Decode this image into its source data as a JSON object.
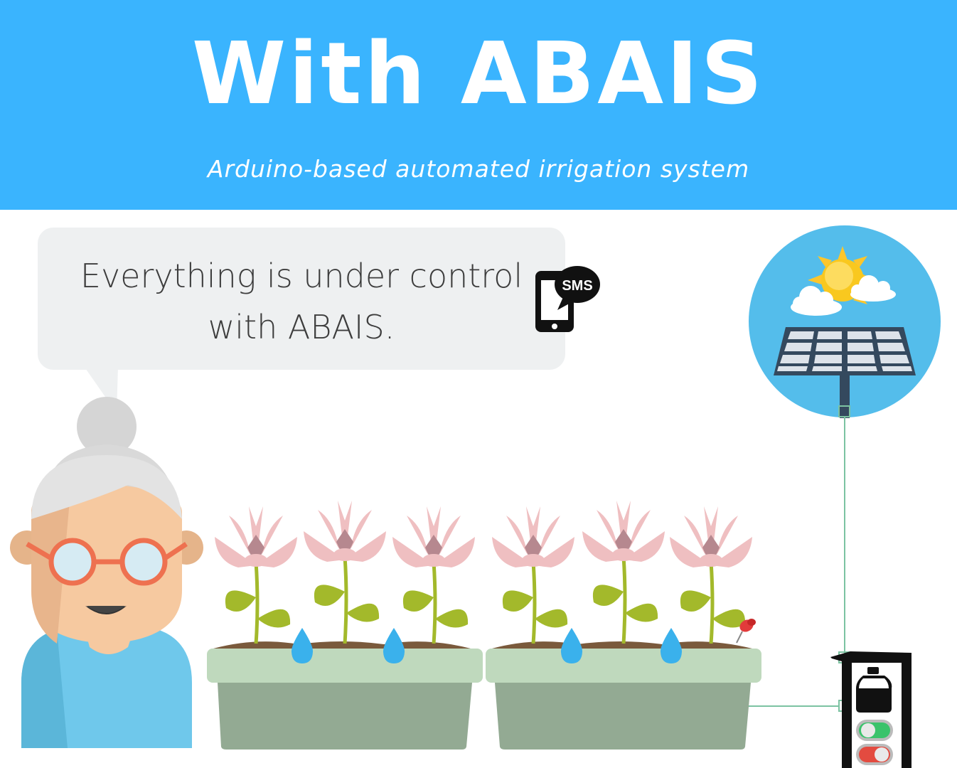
{
  "header": {
    "title": "With ABAIS",
    "subtitle": "Arduino-based automated irrigation system"
  },
  "speech_bubble": {
    "line1": "Everything is under control",
    "line2": "with ABAIS."
  },
  "phone": {
    "badge": "SMS"
  },
  "colors": {
    "header_bg": "#3ab4fe",
    "bubble_bg": "#eef0f1",
    "sky_circle": "#54bdeb",
    "planter_rim": "#bfd9bd",
    "planter_body": "#93aa93",
    "soil": "#7a5a3c",
    "petal": "#efbfc1",
    "leaf": "#a3b92b",
    "drop": "#3ab1ec",
    "wire": "#7cc3a2",
    "switch_on": "#3ac36b",
    "switch_off": "#e34b40",
    "shirt": "#6fc8eb",
    "skin": "#f6c9a0",
    "hair": "#dfdfdf",
    "glasses": "#ee7150"
  },
  "icons": [
    "elderly-woman-icon",
    "sms-phone-icon",
    "sun-icon",
    "cloud-icon",
    "solar-panel-icon",
    "flower-icon",
    "water-drop-icon",
    "pin-icon",
    "water-tank-icon",
    "toggle-switch-icon"
  ],
  "controller": {
    "switch_top_state": "on",
    "switch_bottom_state": "off"
  }
}
